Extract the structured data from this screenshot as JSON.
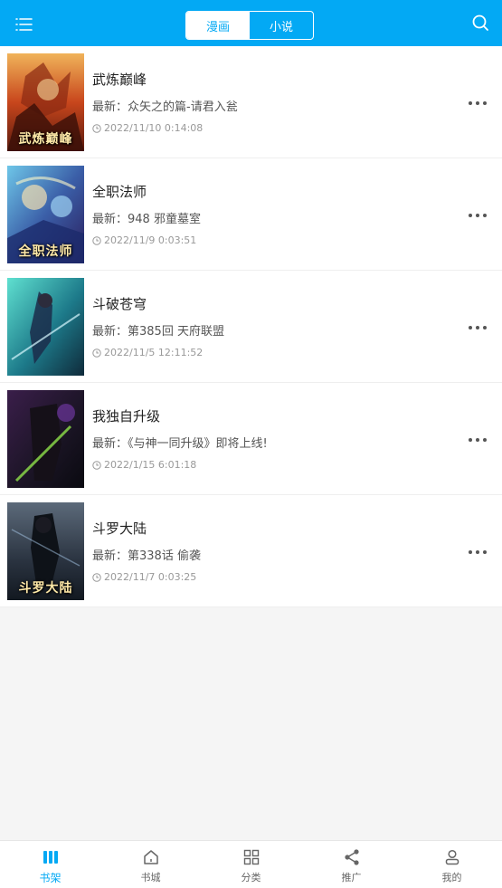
{
  "header": {
    "tabs": [
      {
        "label": "漫画",
        "active": true
      },
      {
        "label": "小说",
        "active": false
      }
    ],
    "menu_icon": "list-menu-icon",
    "search_icon": "search-icon",
    "accent_color": "#03a9f4"
  },
  "books": [
    {
      "title": "武炼巅峰",
      "cover_text": "武炼巅峰",
      "latest": "最新：众矢之的篇-请君入瓮",
      "time": "2022/11/10 0:14:08"
    },
    {
      "title": "全职法师",
      "cover_text": "全职法师",
      "latest": "最新：948 邪童墓室",
      "time": "2022/11/9 0:03:51"
    },
    {
      "title": "斗破苍穹",
      "cover_text": "",
      "latest": "最新：第385回 天府联盟",
      "time": "2022/11/5 12:11:52"
    },
    {
      "title": "我独自升级",
      "cover_text": "",
      "latest": "最新：《与神一同升级》即将上线!",
      "time": "2022/1/15 6:01:18"
    },
    {
      "title": "斗罗大陆",
      "cover_text": "斗罗大陆",
      "latest": "最新：第338话 偷袭",
      "time": "2022/11/7 0:03:25"
    }
  ],
  "bottom_nav": [
    {
      "label": "书架",
      "icon": "bookshelf-icon",
      "active": true
    },
    {
      "label": "书城",
      "icon": "home-icon",
      "active": false
    },
    {
      "label": "分类",
      "icon": "category-grid-icon",
      "active": false
    },
    {
      "label": "推广",
      "icon": "share-icon",
      "active": false
    },
    {
      "label": "我的",
      "icon": "user-icon",
      "active": false
    }
  ]
}
